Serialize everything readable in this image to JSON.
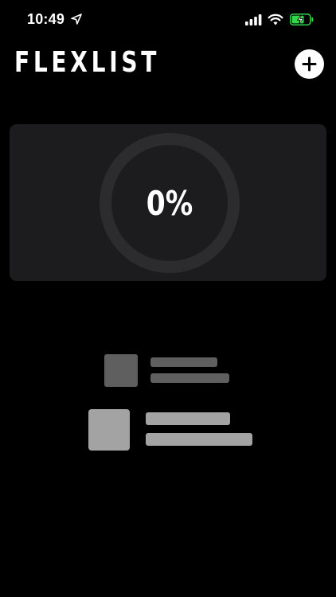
{
  "status_bar": {
    "time": "10:49",
    "icons": [
      "location-arrow-icon",
      "cellular-signal-icon",
      "wifi-icon",
      "battery-charging-icon"
    ],
    "battery_color": "#32d74b"
  },
  "header": {
    "app_name": "FLEXLIST",
    "add_button_icon": "plus-icon"
  },
  "progress": {
    "value_text": "0%",
    "fraction": 0.0,
    "track_color": "#2c2c2e",
    "card_color": "#1c1c1e"
  },
  "empty_state": {
    "icons": [
      "list-placeholder-icon"
    ],
    "colors": {
      "dark_placeholder": "#5f5f5f",
      "light_placeholder": "#a3a3a3"
    }
  }
}
